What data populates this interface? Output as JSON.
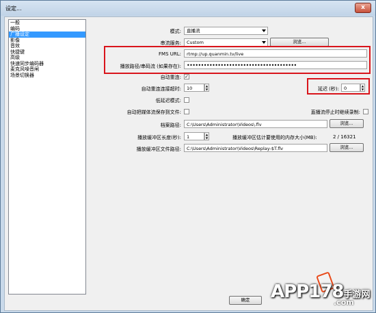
{
  "window": {
    "title": "设定...",
    "close_label": "x"
  },
  "sidebar": {
    "items": [
      "一般",
      "编码",
      "广播设定",
      "影像",
      "音效",
      "快捷键",
      "高级",
      "快速同步编码器",
      "麦克风噪音闸",
      "场景切换器"
    ],
    "selected": 2
  },
  "form": {
    "mode_label": "模式:",
    "mode_value": "直播流",
    "service_label": "串流服务:",
    "service_value": "Custom",
    "browse_label": "浏览...",
    "fms_label": "FMS URL:",
    "fms_value": "rtmp://up.quanmin.tv/live",
    "key_label": "播放路径/串码流 (如果存在):",
    "key_value": "•••••••••••••••••••••••••••••••••••••••",
    "auto_reconnect_label": "自动重连:",
    "auto_reconnect_checked": true,
    "reconnect_timeout_label": "自动重连连接超时:",
    "reconnect_timeout_value": "10",
    "delay_label": "延迟 (秒):",
    "delay_value": "0",
    "low_latency_label": "低延迟模式:",
    "save_to_file_label": "自动把媒体流保存到文件:",
    "stop_record_label": "直播流停止时继续录制:",
    "archive_path_label": "档案路径:",
    "archive_path_value": "C:\\Users\\Administrator\\Videos\\.flv",
    "replay_length_label": "播放缓冲区长度(秒):",
    "replay_length_value": "1",
    "replay_memory_label": "播放缓冲区估计要使用的内存大小(MB):",
    "replay_memory_value": "2 / 16321",
    "replay_path_label": "播放缓冲区文件路径:",
    "replay_path_value": "C:\\Users\\Administrator\\Videos\\Replay-$T.flv",
    "ok_label": "确定"
  },
  "watermark": {
    "text_main": "APP178",
    "text_sub": "手游网",
    "text_domain": ".com"
  },
  "colors": {
    "highlight": "#d9141b",
    "selection": "#3399ff"
  }
}
